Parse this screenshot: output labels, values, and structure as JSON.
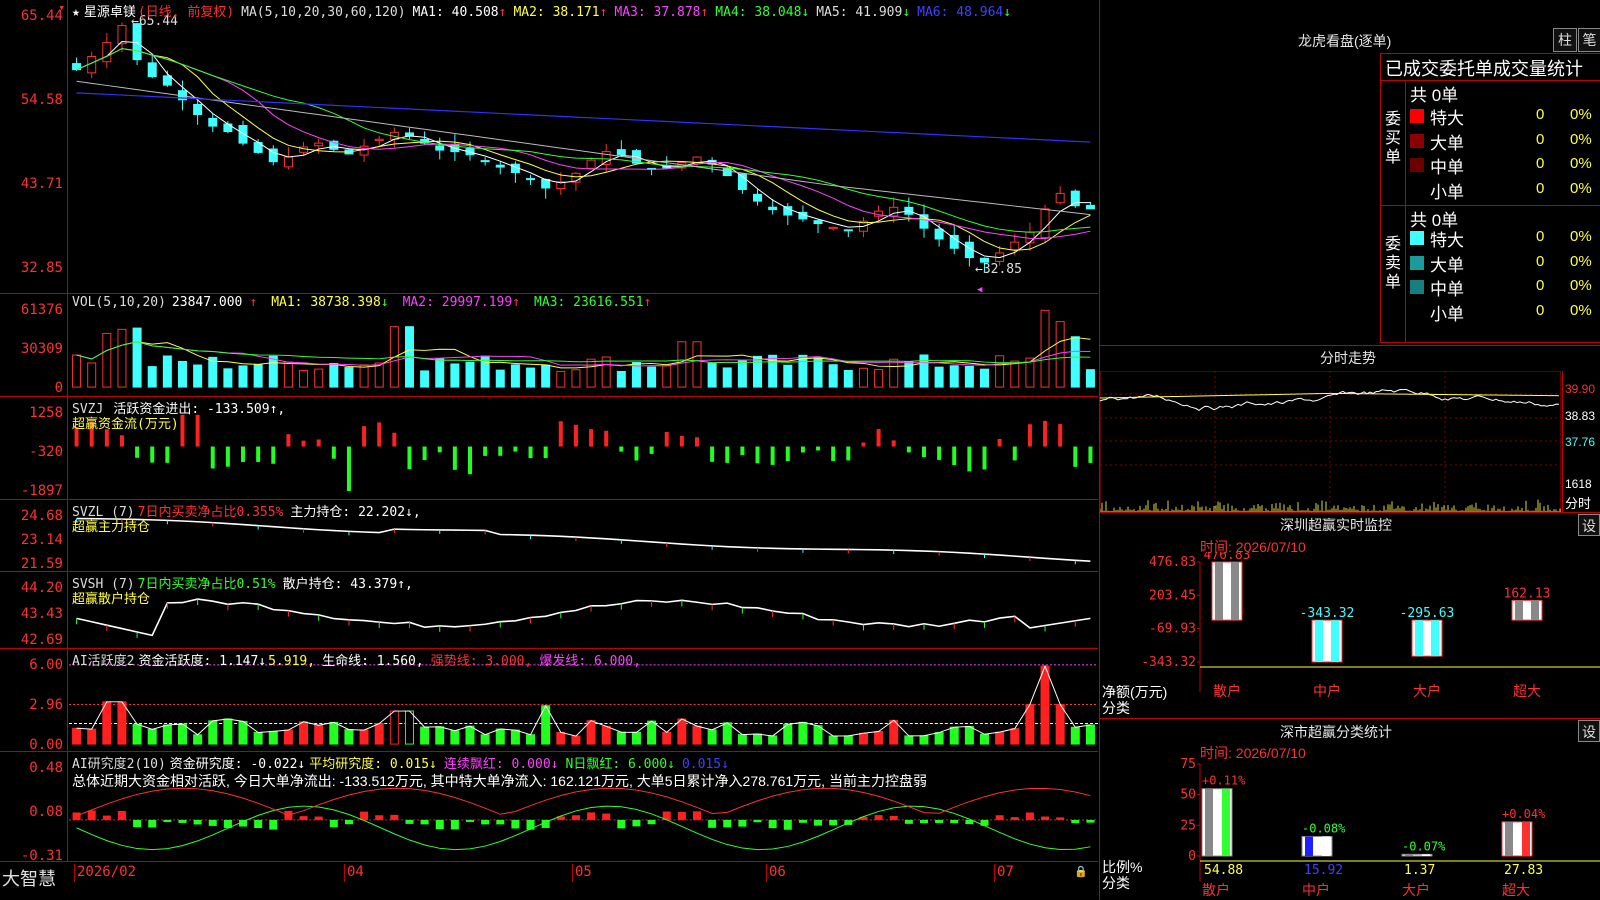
{
  "app": {
    "name": "大智慧"
  },
  "stock": {
    "name": "星源卓镁",
    "period": "(日线, 前复权)"
  },
  "main": {
    "ma_label": "MA(5,10,20,30,60,120)",
    "ma": [
      {
        "label": "MA1:",
        "value": "40.508",
        "arrow": "↑",
        "color": "#ffffff"
      },
      {
        "label": "MA2:",
        "value": "38.171",
        "arrow": "↑",
        "color": "#ffff40"
      },
      {
        "label": "MA3:",
        "value": "37.878",
        "arrow": "↑",
        "color": "#ff40ff"
      },
      {
        "label": "MA4:",
        "value": "38.048",
        "arrow": "↓",
        "color": "#30ff30"
      },
      {
        "label": "MA5:",
        "value": "41.909",
        "arrow": "↓",
        "color": "#dddddd"
      },
      {
        "label": "MA6:",
        "value": "48.964",
        "arrow": "↓",
        "color": "#4040ff"
      }
    ],
    "yticks": [
      "65.44",
      "54.58",
      "43.71",
      "32.85"
    ],
    "high_label": "65.44",
    "low_label": "32.85"
  },
  "vol": {
    "label": "VOL(5,10,20)",
    "value": "23847.000",
    "arrow": "↑",
    "ma": [
      {
        "label": "MA1:",
        "value": "38738.398",
        "arrow": "↓",
        "color": "#ffff40"
      },
      {
        "label": "MA2:",
        "value": "29997.199",
        "arrow": "↑",
        "color": "#ff40ff"
      },
      {
        "label": "MA3:",
        "value": "23616.551",
        "arrow": "↑",
        "color": "#30ff30"
      }
    ],
    "yticks": [
      "61376",
      "30309",
      "0"
    ]
  },
  "svzj": {
    "label": "SVZJ",
    "text": "活跃资金进出: -133.509↑,",
    "sub": "超赢资金流(万元)",
    "yticks": [
      "1258",
      "-320",
      "-1897"
    ]
  },
  "svzl": {
    "label": "SVZL (7)",
    "pct": "7日内买卖净占比0.355%",
    "hold": "主力持仓: 22.202↓,",
    "sub": "超赢主力持仓",
    "yticks": [
      "24.68",
      "23.14",
      "21.59"
    ]
  },
  "svsh": {
    "label": "SVSH (7)",
    "pct": "7日内买卖净占比0.51%",
    "hold": "散户持仓: 43.379↑,",
    "sub": "超赢散户持仓",
    "yticks": [
      "44.20",
      "43.43",
      "42.69"
    ]
  },
  "ai1": {
    "label": "AI活跃度2",
    "fund": "资金活跃度: 1.147↓",
    "v2": "5.919,",
    "life": "生命线: 1.560,",
    "strong": "强势线: 3.000,",
    "burst": "爆发线: 6.000,",
    "yticks": [
      "6.00",
      "2.96",
      "0.00"
    ]
  },
  "ai2": {
    "label": "AI研究度2(10)",
    "fund": "资金研究度: -0.022↓",
    "avg": "平均研究度: 0.015↓",
    "lian": "连续飘红: 0.000↓",
    "n": "N日飘红: 6.000↓",
    "last": "0.015↓",
    "yticks": [
      "0.48",
      "0.08",
      "-0.31"
    ],
    "summary": "总体近期大资金相对活跃, 今日大单净流出: -133.512万元, 其中特大单净流入: 162.121万元, 大单5日累计净入278.761万元, 当前主力控盘弱"
  },
  "xaxis": [
    "2026/02",
    "04",
    "05",
    "06",
    "07"
  ],
  "right": {
    "lhb_title": "龙虎看盘(逐单)",
    "btn_zhu": "柱",
    "btn_bi": "笔",
    "stat_title": "已成交委托单成交量统计",
    "buy": {
      "label": "委买单",
      "total": "共 0单",
      "rows": [
        {
          "name": "特大",
          "count": "0",
          "pct": "0%",
          "color": "#ff0000"
        },
        {
          "name": "大单",
          "count": "0",
          "pct": "0%",
          "color": "#8b0000"
        },
        {
          "name": "中单",
          "count": "0",
          "pct": "0%",
          "color": "#6a0000"
        },
        {
          "name": "小单",
          "count": "0",
          "pct": "0%",
          "color": ""
        }
      ]
    },
    "sell": {
      "label": "委卖单",
      "total": "共 0单",
      "rows": [
        {
          "name": "特大",
          "count": "0",
          "pct": "0%",
          "color": "#40ffff"
        },
        {
          "name": "大单",
          "count": "0",
          "pct": "0%",
          "color": "#1a9c9c"
        },
        {
          "name": "中单",
          "count": "0",
          "pct": "0%",
          "color": "#177f7f"
        },
        {
          "name": "小单",
          "count": "0",
          "pct": "0%",
          "color": ""
        }
      ]
    },
    "fenshi": {
      "title": "分时走势",
      "yticks": [
        "39.90",
        "38.83",
        "37.76"
      ],
      "vol_tick": "1618",
      "vol_label": "分时"
    },
    "monitor": {
      "title": "深圳超赢实时监控",
      "btn": "设",
      "time": "时间: 2026/07/10",
      "yticks": [
        "476.83",
        "203.45",
        "-69.93",
        "-343.32"
      ],
      "ylabel1": "净额(万元)",
      "ylabel2": "分类",
      "bars": [
        {
          "cat": "散户",
          "value": 476.83,
          "label": "476.83"
        },
        {
          "cat": "中户",
          "value": -343.32,
          "label": "-343.32"
        },
        {
          "cat": "大户",
          "value": -295.63,
          "label": "-295.63"
        },
        {
          "cat": "超大",
          "value": 162.13,
          "label": "162.13"
        }
      ]
    },
    "classify": {
      "title": "深市超赢分类统计",
      "btn": "设",
      "time": "时间: 2026/07/10",
      "yticks": [
        "75",
        "50",
        "25",
        "0"
      ],
      "ylabel1": "比例%",
      "ylabel2": "分类",
      "bars": [
        {
          "cat": "散户",
          "value": 54.88,
          "label": "54.88",
          "delta": "+0.11%"
        },
        {
          "cat": "中户",
          "value": 15.92,
          "label": "15.92",
          "delta": "-0.08%"
        },
        {
          "cat": "大户",
          "value": 1.37,
          "label": "1.37",
          "delta": "-0.07%"
        },
        {
          "cat": "超大",
          "value": 27.83,
          "label": "27.83",
          "delta": "+0.04%"
        }
      ]
    }
  },
  "chart_data": [
    {
      "type": "candlestick",
      "title": "星源卓镁 (日线, 前复权)",
      "ylim": [
        32.85,
        65.44
      ],
      "high": 65.44,
      "low": 32.85,
      "x": [
        "2026/02",
        "04",
        "05",
        "06",
        "07"
      ],
      "ma_series": [
        {
          "name": "MA1",
          "last": 40.508
        },
        {
          "name": "MA2",
          "last": 38.171
        },
        {
          "name": "MA3",
          "last": 37.878
        },
        {
          "name": "MA4",
          "last": 38.048
        },
        {
          "name": "MA5",
          "last": 41.909
        },
        {
          "name": "MA6",
          "last": 48.964
        }
      ],
      "close": [
        58.5,
        60.2,
        62.0,
        64.2,
        59.8,
        57.6,
        56.5,
        54.6,
        52.7,
        51.2,
        50.5,
        49.0,
        47.8,
        46.6,
        47.2,
        48.5,
        49.0,
        48.2,
        47.6,
        48.6,
        49.5,
        50.4,
        49.9,
        49.0,
        48.1,
        47.9,
        47.5,
        46.6,
        45.9,
        45.2,
        44.4,
        43.2,
        44.0,
        45.1,
        46.8,
        47.9,
        47.5,
        46.4,
        45.6,
        45.8,
        46.5,
        47.2,
        46.3,
        44.8,
        43.0,
        41.5,
        40.4,
        39.7,
        39.2,
        38.6,
        38.1,
        37.7,
        38.9,
        40.2,
        40.7,
        39.8,
        38.0,
        36.6,
        35.4,
        34.2,
        33.6,
        34.8,
        36.2,
        37.5,
        40.5,
        42.5,
        40.9,
        40.5
      ]
    },
    {
      "type": "bar",
      "title": "VOL(5,10,20)",
      "ylim": [
        0,
        61376
      ],
      "last": 23847
    },
    {
      "type": "bar",
      "title": "SVZJ 超赢资金流(万元)",
      "ylim": [
        -1897,
        1258
      ],
      "last": -133.509
    },
    {
      "type": "line",
      "title": "SVZL 超赢主力持仓",
      "ylim": [
        21.59,
        24.68
      ],
      "last": 22.202
    },
    {
      "type": "line",
      "title": "SVSH 超赢散户持仓",
      "ylim": [
        42.69,
        44.2
      ],
      "last": 43.379
    },
    {
      "type": "bar",
      "title": "AI活跃度2",
      "ylim": [
        0,
        6.0
      ],
      "last": 1.147
    },
    {
      "type": "bar",
      "title": "AI研究度2(10)",
      "ylim": [
        -0.31,
        0.48
      ],
      "last": -0.022
    }
  ]
}
